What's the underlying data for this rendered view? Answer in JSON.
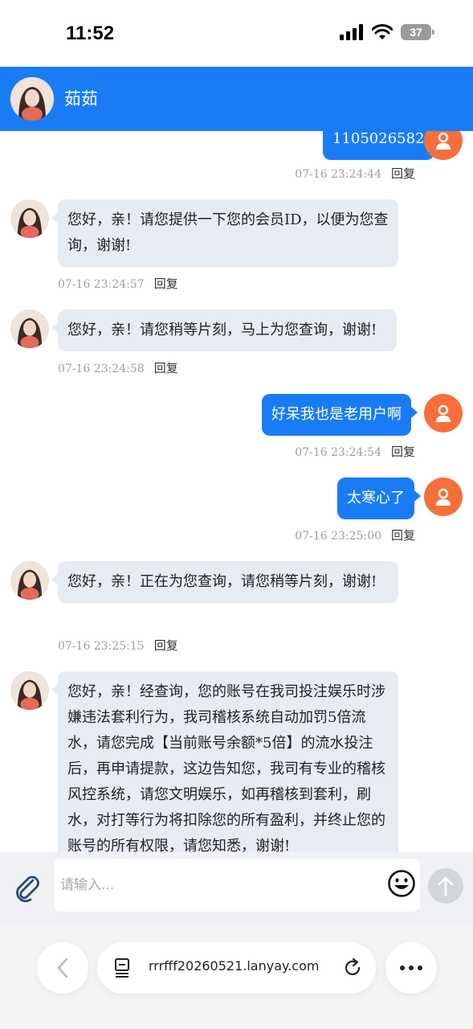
{
  "status_bar": {
    "time": "11:52",
    "battery": "37"
  },
  "header": {
    "title": "茹茹"
  },
  "messages": [
    {
      "side": "right",
      "text": "1105026582",
      "time": "07-16 23:24:44",
      "reply": "回复"
    },
    {
      "side": "left",
      "text": "您好，亲！请您提供一下您的会员ID，以便为您查询，谢谢!",
      "time": "07-16 23:24:57",
      "reply": "回复"
    },
    {
      "side": "left",
      "text": "您好，亲！请您稍等片刻，马上为您查询，谢谢!",
      "time": "07-16 23:24:58",
      "reply": "回复"
    },
    {
      "side": "right",
      "text": "好呆我也是老用户啊",
      "time": "07-16 23:24:54",
      "reply": "回复"
    },
    {
      "side": "right",
      "text": "太寒心了",
      "time": "07-16 23:25:00",
      "reply": "回复"
    },
    {
      "side": "left",
      "text": "您好，亲！正在为您查询，请您稍等片刻，谢谢!",
      "time": "07-16 23:25:15",
      "reply": "回复"
    },
    {
      "side": "left",
      "text": "您好，亲！经查询，您的账号在我司投注娱乐时涉嫌违法套利行为，我司稽核系统自动加罚5倍流水，请您完成【当前账号余额*5倍】的流水投注后，再申请提款，这边告知您，我司有专业的稽核风控系统，请您文明娱乐，如再稽核到套利，刷水，对打等行为将扣除您的所有盈利，并终止您的账号的所有权限，请您知悉，谢谢!"
    }
  ],
  "input": {
    "placeholder": "请输入...",
    "value": ""
  },
  "browser": {
    "url": "rrrfff20260521.lanyay.com"
  },
  "colors": {
    "header": "#1a7cf5",
    "user_bubble": "#1a7cf5",
    "agent_bubble": "#e7ebf2",
    "user_avatar": "#f5703b"
  },
  "icons": [
    "signal-icon",
    "wifi-icon",
    "battery-icon",
    "paperclip-icon",
    "emoji-icon",
    "send-arrow-icon",
    "back-arrow-icon",
    "tabs-icon",
    "reload-icon",
    "more-icon",
    "user-icon"
  ]
}
